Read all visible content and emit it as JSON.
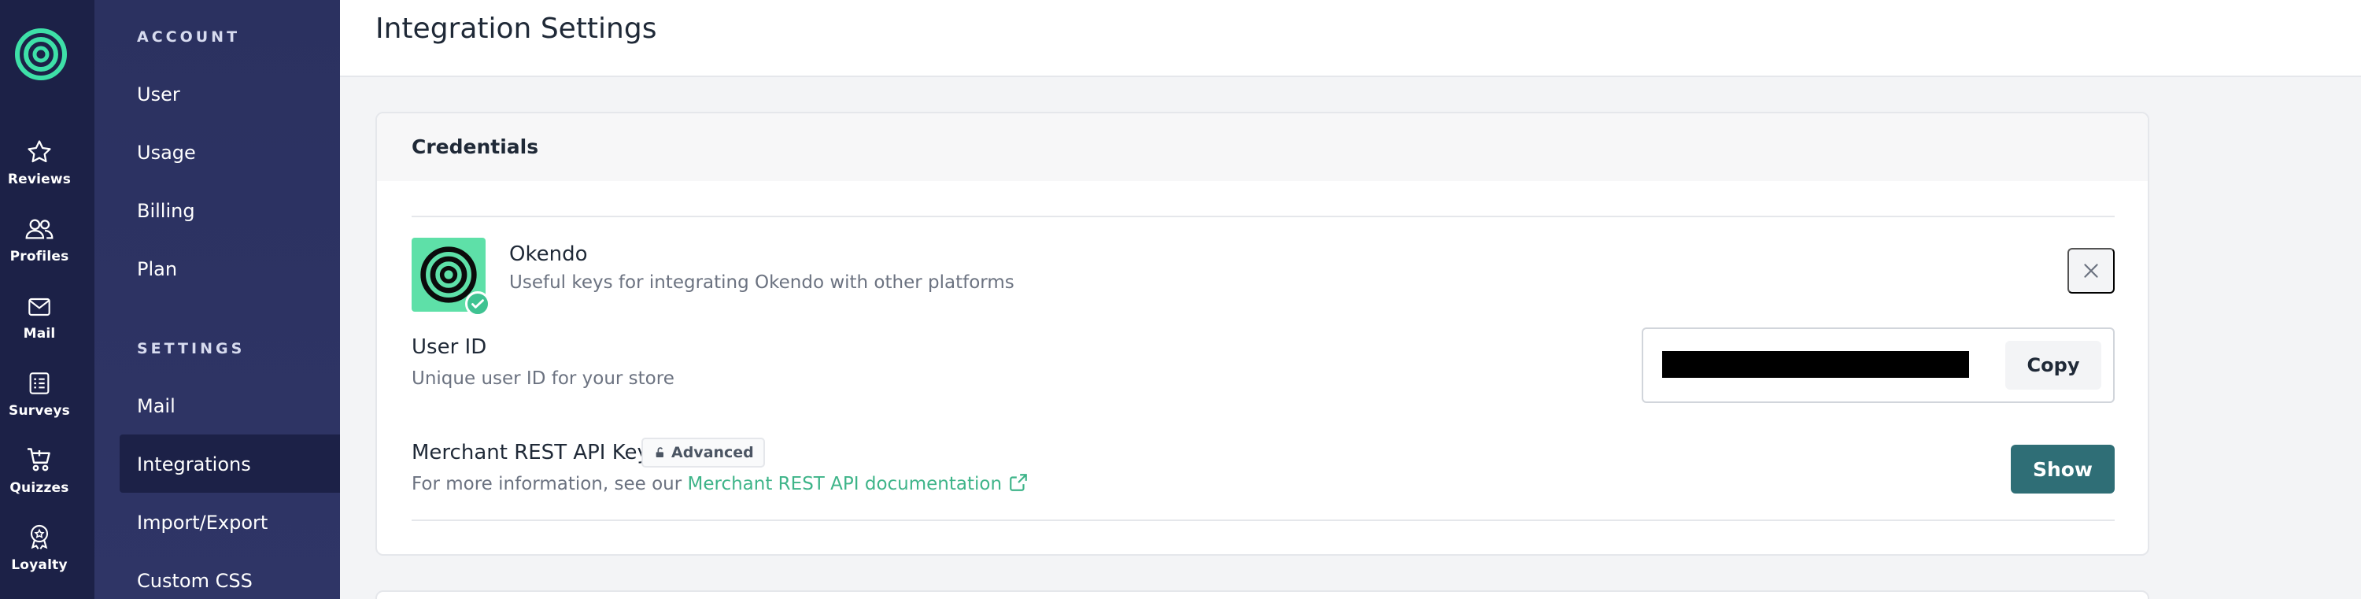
{
  "rail": {
    "items": [
      {
        "label": "Reviews",
        "icon": "star-icon"
      },
      {
        "label": "Profiles",
        "icon": "users-icon"
      },
      {
        "label": "Mail",
        "icon": "mail-icon"
      },
      {
        "label": "Surveys",
        "icon": "checklist-icon"
      },
      {
        "label": "Quizzes",
        "icon": "cart-icon"
      },
      {
        "label": "Loyalty",
        "icon": "badge-icon"
      }
    ]
  },
  "sidebar": {
    "account_heading": "ACCOUNT",
    "account_items": [
      "User",
      "Usage",
      "Billing",
      "Plan"
    ],
    "settings_heading": "SETTINGS",
    "settings_items": [
      "Mail",
      "Integrations",
      "Import/Export",
      "Custom CSS"
    ],
    "active_item": "Integrations"
  },
  "page": {
    "title": "Integration Settings"
  },
  "credentials": {
    "title": "Credentials",
    "app_name": "Okendo",
    "app_description": "Useful keys for integrating Okendo with other platforms",
    "user_id": {
      "label": "User ID",
      "help": "Unique user ID for your store",
      "value": "",
      "copy_label": "Copy"
    },
    "api_key": {
      "label": "Merchant REST API Key",
      "badge": "Advanced",
      "help_prefix": "For more information, see our ",
      "link_text": "Merchant REST API documentation",
      "show_label": "Show"
    }
  },
  "colors": {
    "rail_bg": "#1c2147",
    "sidebar_bg": "#2b3160",
    "brand_green": "#5ee0a8",
    "link_green": "#3eb489",
    "primary_button": "#2f6e76"
  }
}
